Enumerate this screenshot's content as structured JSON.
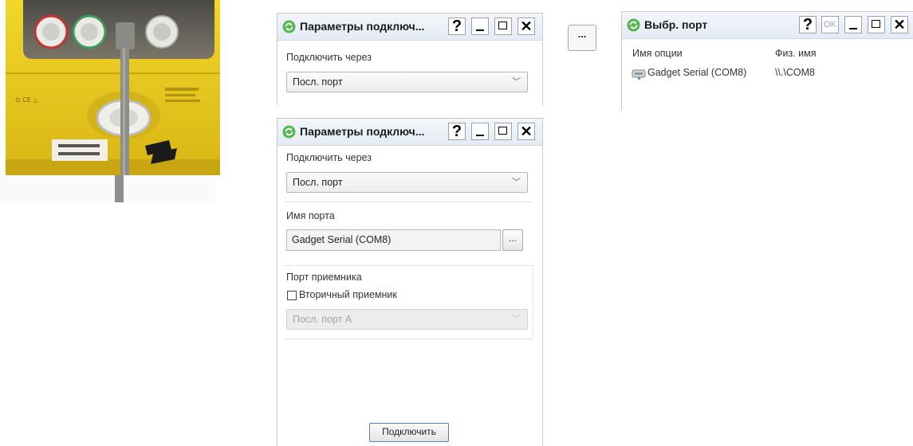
{
  "window_top": {
    "title": "Параметры подключ...",
    "connect_via_label": "Подключить через",
    "connect_via_value": "Посл. порт"
  },
  "dots_button": {
    "label": "..."
  },
  "port_dialog": {
    "title": "Выбр. порт",
    "ok_label": "OK",
    "col_option": "Имя опции",
    "col_phys": "Физ. имя",
    "row_option": "Gadget Serial (COM8)",
    "row_phys": "\\\\.\\COM8"
  },
  "window_main": {
    "title": "Параметры подключ...",
    "connect_via_label": "Подключить через",
    "connect_via_value": "Посл. порт",
    "port_name_label": "Имя порта",
    "port_name_value": "Gadget Serial (COM8)",
    "browse_label": "...",
    "receiver_port_label": "Порт приемника",
    "secondary_receiver_label": "Вторичный приемник",
    "secondary_receiver_checked": false,
    "receiver_port_value": "Посл. порт А",
    "connect_button": "Подключить"
  },
  "buttons": {
    "help": "?"
  },
  "colors": {
    "device_yellow": "#e8c81e",
    "titlebar": "#e4ebf5",
    "app_icon_green": "#3aa53a"
  },
  "icons": [
    "app-refresh-icon",
    "help-icon",
    "minimize-icon",
    "maximize-icon",
    "close-icon",
    "chevron-down-icon",
    "serial-port-icon"
  ]
}
